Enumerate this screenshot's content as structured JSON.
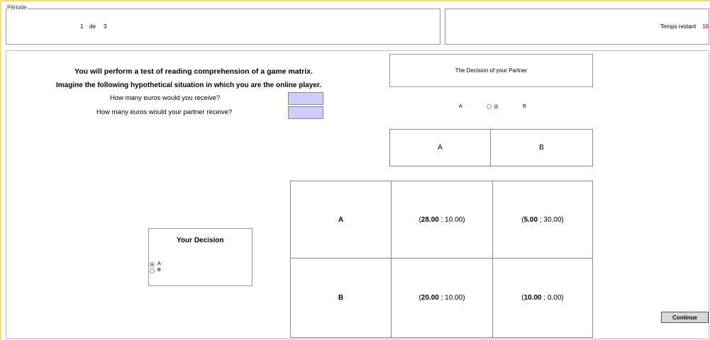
{
  "header": {
    "period_legend": "Période",
    "period_current": "1",
    "period_of": "de",
    "period_total": "3",
    "time_label": "Temps restant",
    "time_value": "18",
    "time_color": "#d40000"
  },
  "instructions": {
    "line1": "You will perform a test of reading comprehension of a game matrix.",
    "line2": "Imagine the following hypothetical situation in which you are the online player.",
    "q1": "How many euros would you receive?",
    "q2": "How many euros would your partner receive?",
    "q1_value": "",
    "q2_value": ""
  },
  "partner": {
    "title": "The Decision of your Partner",
    "option_a": "A",
    "option_b": "B",
    "selected": "B",
    "col_a": "A",
    "col_b": "B"
  },
  "matrix": {
    "rows": [
      {
        "label": "A",
        "cells": [
          {
            "bold": "28.00",
            "rest": " ; 10.00)"
          },
          {
            "bold": "5.00",
            "rest": " ; 30.00)"
          }
        ]
      },
      {
        "label": "B",
        "cells": [
          {
            "bold": "20.00",
            "rest": " ; 10.00)"
          },
          {
            "bold": "10.00",
            "rest": " ; 0.00)"
          }
        ]
      }
    ],
    "open_paren": "("
  },
  "your_decision": {
    "title": "Your Decision",
    "option_a": "A",
    "option_b": "B",
    "selected": "A"
  },
  "continue_label": "Continue",
  "accent_input": "#ccccff"
}
